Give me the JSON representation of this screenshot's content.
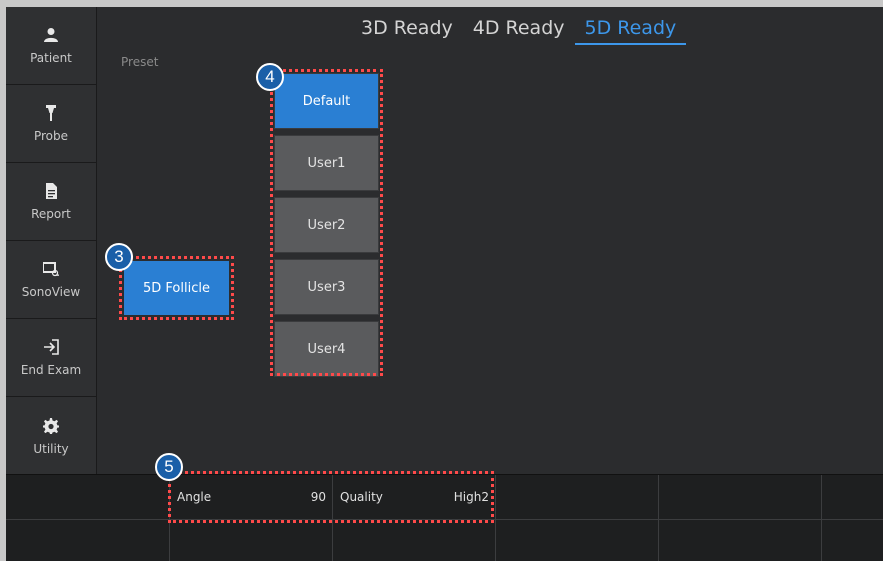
{
  "sidebar": {
    "items": [
      {
        "label": "Patient",
        "icon": "person-icon"
      },
      {
        "label": "Probe",
        "icon": "probe-icon"
      },
      {
        "label": "Report",
        "icon": "document-icon"
      },
      {
        "label": "SonoView",
        "icon": "sonoview-icon"
      },
      {
        "label": "End Exam",
        "icon": "exit-icon"
      },
      {
        "label": "Utility",
        "icon": "gear-icon"
      }
    ]
  },
  "tabs": [
    {
      "label": "3D Ready",
      "active": false
    },
    {
      "label": "4D Ready",
      "active": false
    },
    {
      "label": "5D Ready",
      "active": true
    }
  ],
  "preset": {
    "label": "Preset",
    "mode_button": "5D Follicle",
    "items": [
      "Default",
      "User1",
      "User2",
      "User3",
      "User4"
    ],
    "selected": "Default"
  },
  "params": [
    {
      "label": "Angle",
      "value": "90"
    },
    {
      "label": "Quality",
      "value": "High2"
    }
  ],
  "callouts": [
    "3",
    "4",
    "5"
  ],
  "colors": {
    "accent": "#2a7fd3",
    "tab_active": "#3d97ea",
    "callout_border": "#ff4a4a"
  }
}
